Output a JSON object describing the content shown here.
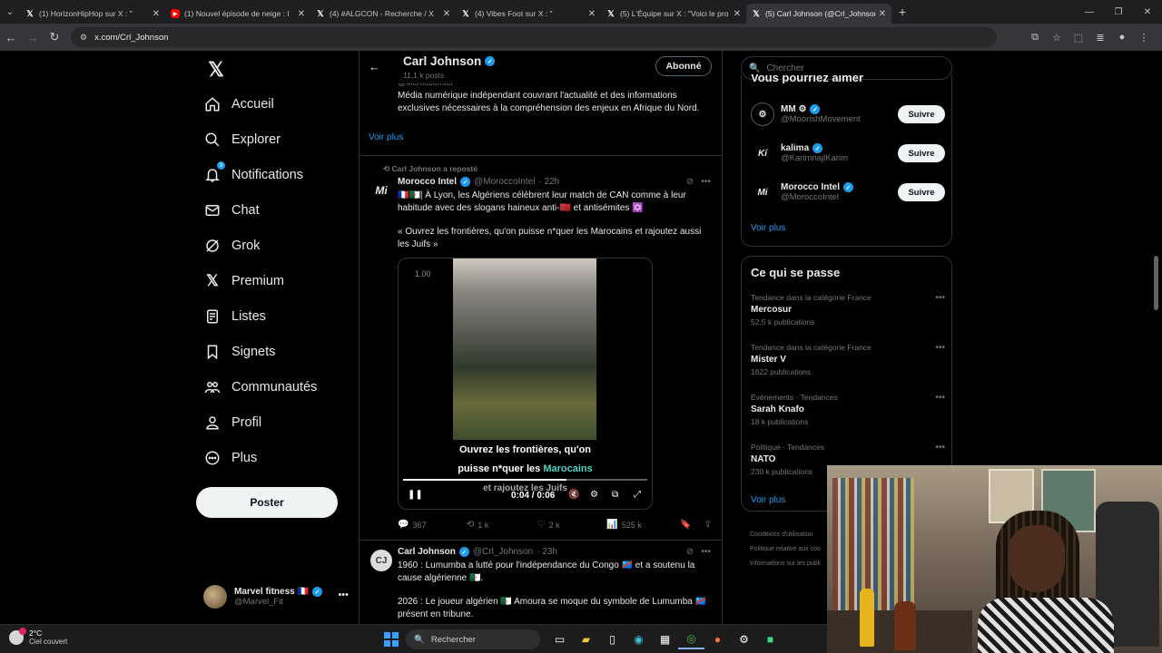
{
  "browser": {
    "tabs": [
      {
        "title": "(1) HorizonHipHop sur X : \"",
        "icon": "x-logo-icon"
      },
      {
        "title": "(1) Nouvel épisode de neige : l",
        "icon": "youtube-icon"
      },
      {
        "title": "(4) #ALGCON - Recherche / X",
        "icon": "x-logo-icon"
      },
      {
        "title": "(4) Vibes Foot sur X : \"",
        "icon": "x-logo-icon"
      },
      {
        "title": "(5) L'Équipe sur X : \"Voici le pro",
        "icon": "x-logo-icon"
      },
      {
        "title": "(5) Carl Johnson (@Crl_Johnson",
        "icon": "x-logo-icon",
        "active": true
      }
    ],
    "new_tab": "+",
    "url": "x.com/Crl_Johnson"
  },
  "nav": {
    "items": [
      {
        "label": "Accueil",
        "icon": "home-icon"
      },
      {
        "label": "Explorer",
        "icon": "search-icon"
      },
      {
        "label": "Notifications",
        "icon": "bell-icon",
        "badge": "9"
      },
      {
        "label": "Chat",
        "icon": "mail-icon"
      },
      {
        "label": "Grok",
        "icon": "grok-icon"
      },
      {
        "label": "Premium",
        "icon": "x-logo-icon"
      },
      {
        "label": "Listes",
        "icon": "list-icon"
      },
      {
        "label": "Signets",
        "icon": "bookmark-icon"
      },
      {
        "label": "Communautés",
        "icon": "communities-icon"
      },
      {
        "label": "Profil",
        "icon": "person-icon"
      },
      {
        "label": "Plus",
        "icon": "more-circle-icon"
      }
    ],
    "post_label": "Poster",
    "account": {
      "name": "Marvel fitness 🇫🇷",
      "handle": "@Marvel_Fit"
    }
  },
  "header": {
    "name": "Carl Johnson",
    "posts": "11,1 k posts",
    "follow_label": "Abonné"
  },
  "bio_block": {
    "handle": "@MoroccoIntel",
    "text": "Média numérique indépendant couvrant l'actualité et des informations exclusives nécessaires à la compréhension des enjeux en Afrique du Nord.",
    "voir_plus": "Voir plus"
  },
  "tweet1": {
    "repost_label": "Carl Johnson a reposté",
    "name": "Morocco Intel",
    "handle": "@MoroccoIntel",
    "time": "· 22h",
    "text1": "🇫🇷🇩🇿| À Lyon, les Algériens célèbrent leur match de CAN comme à leur habitude avec des slogans haineux anti-🇲🇦 et antisémites ✡️",
    "text2": "« Ouvrez les frontières, qu'on puisse n*quer les Marocains et rajoutez aussi les Juifs »",
    "video": {
      "speed": "1.00",
      "caption_line1": "Ouvrez les frontières, qu'on",
      "caption_line2_a": "puisse n*quer les ",
      "caption_line2_b": "Marocains",
      "caption_line3": "et rajoutez les Juifs",
      "time": "0:04 / 0:06",
      "progress": 0.67
    },
    "replies": "367",
    "reposts": "1 k",
    "likes": "2 k",
    "views": "525 k"
  },
  "tweet2": {
    "name": "Carl Johnson",
    "handle": "@Crl_Johnson",
    "time": "· 23h",
    "text1": "1960 : Lumumba a lutté pour l'indépendance du Congo 🇨🇩 et a soutenu la cause algérienne 🇩🇿.",
    "text2": "2026 : Le joueur algérien 🇩🇿 Amoura se moque du symbole de Lumumba 🇨🇩 présent en tribune."
  },
  "right": {
    "search_placeholder": "Chercher",
    "suggestions_title": "Vous pourriez aimer",
    "suggestions": [
      {
        "name": "MM ⚙",
        "handle": "@MoorishMovement",
        "follow": "Suivre"
      },
      {
        "name": "kalima",
        "handle": "@KarimnajlKarim",
        "follow": "Suivre"
      },
      {
        "name": "Morocco Intel",
        "handle": "@MoroccoIntel",
        "follow": "Suivre"
      }
    ],
    "voir_plus": "Voir plus",
    "trends_title": "Ce qui se passe",
    "trends": [
      {
        "category": "Tendance dans la catégorie France",
        "name": "Mercosur",
        "count": "52,5 k publications"
      },
      {
        "category": "Tendance dans la catégorie France",
        "name": "Mister V",
        "count": "1622 publications"
      },
      {
        "category": "Événements · Tendances",
        "name": "Sarah Knafo",
        "count": "18 k publications"
      },
      {
        "category": "Politique · Tendances",
        "name": "NATO",
        "count": "230 k publications"
      }
    ],
    "trends_voir_plus": "Voir plus",
    "footer": [
      "Conditions d'utilisation",
      "Politique relative aux coo",
      "Informations sur les publi"
    ]
  },
  "taskbar": {
    "temp": "2°C",
    "weather": "Ciel couvert",
    "search": "Rechercher"
  }
}
